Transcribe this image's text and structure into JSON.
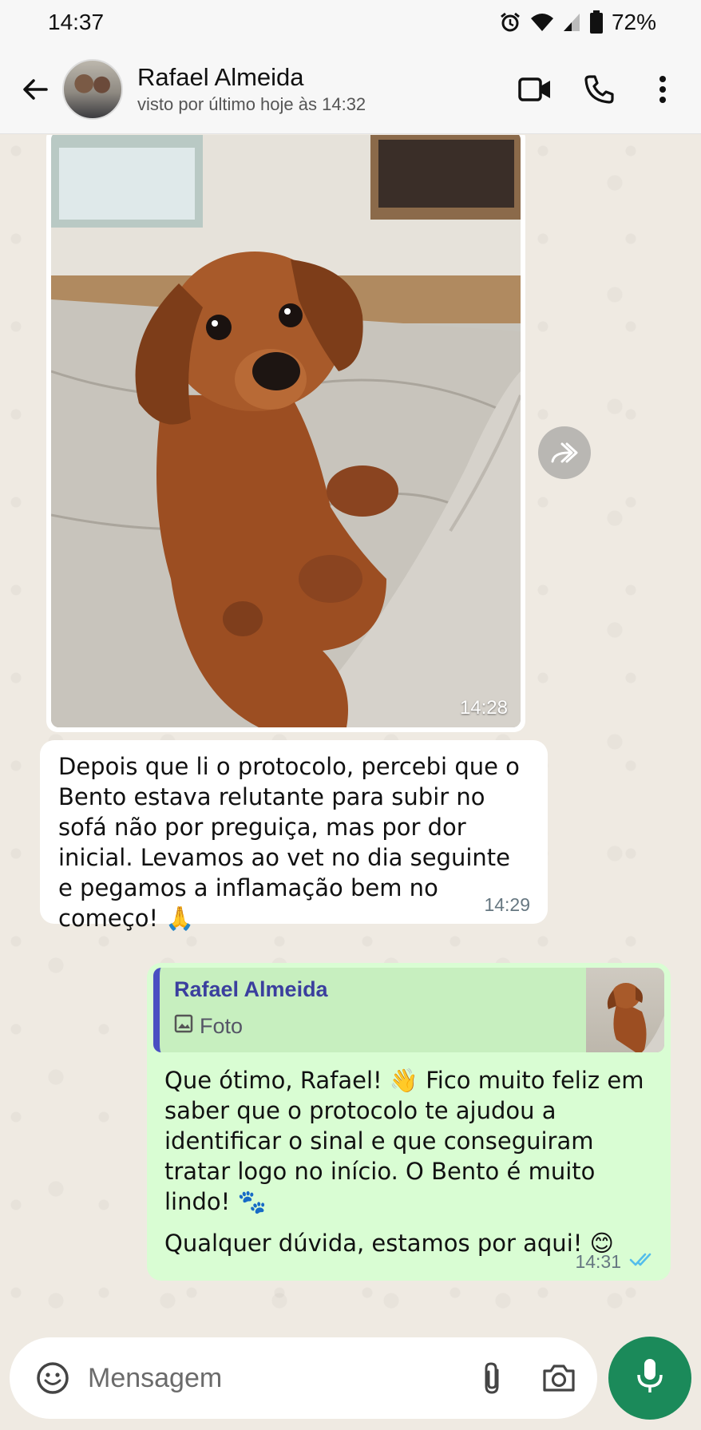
{
  "status_bar": {
    "time": "14:37",
    "battery": "72%",
    "icons": [
      "alarm-icon",
      "wifi-icon",
      "signal-icon",
      "battery-icon"
    ]
  },
  "header": {
    "contact_name": "Rafael Almeida",
    "last_seen": "visto por último hoje às 14:32",
    "icons": [
      "back-arrow-icon",
      "video-call-icon",
      "phone-icon",
      "more-vert-icon"
    ]
  },
  "messages": {
    "photo": {
      "time": "14:28"
    },
    "incoming": {
      "text": "Depois que li o protocolo, percebi que o Bento estava relutante para subir no sofá não por preguiça, mas por dor inicial. Levamos ao vet no dia seguinte e pegamos a inflamação bem no começo! 🙏",
      "time": "14:29"
    },
    "outgoing": {
      "quote_name": "Rafael Almeida",
      "quote_type": "Foto",
      "paragraph1": "Que ótimo, Rafael! 👋 Fico muito feliz em saber que o protocolo te ajudou a identificar o sinal e que conseguiram tratar logo no início. O Bento é muito lindo! 🐾",
      "paragraph2": "Qualquer dúvida, estamos por aqui! 😊",
      "time": "14:31",
      "read_status": "double-check-icon"
    }
  },
  "composer": {
    "placeholder": "Mensagem",
    "icons": [
      "emoji-icon",
      "attach-icon",
      "camera-icon",
      "mic-icon"
    ]
  },
  "colors": {
    "chat_bg": "#efeae2",
    "outgoing_bubble": "#d9fdd3",
    "incoming_bubble": "#ffffff",
    "accent_green": "#1b8a5a",
    "read_tick": "#53bdeb"
  }
}
